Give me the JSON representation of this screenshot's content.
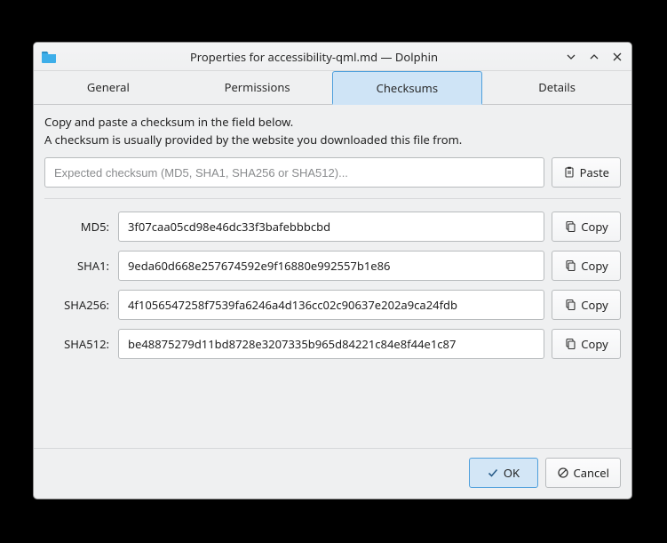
{
  "titlebar": {
    "title": "Properties for accessibility-qml.md — Dolphin"
  },
  "tabs": {
    "general": "General",
    "permissions": "Permissions",
    "checksums": "Checksums",
    "details": "Details"
  },
  "intro": {
    "line1": "Copy and paste a checksum in the field below.",
    "line2": "A checksum is usually provided by the website you downloaded this file from."
  },
  "input": {
    "placeholder": "Expected checksum (MD5, SHA1, SHA256 or SHA512)...",
    "value": ""
  },
  "buttons": {
    "paste": "Paste",
    "copy": "Copy",
    "ok": "OK",
    "cancel": "Cancel"
  },
  "checksums": {
    "md5": {
      "label": "MD5:",
      "value": "3f07caa05cd98e46dc33f3bafebbbcbd"
    },
    "sha1": {
      "label": "SHA1:",
      "value": "9eda60d668e257674592e9f16880e992557b1e86"
    },
    "sha256": {
      "label": "SHA256:",
      "value": "4f1056547258f7539fa6246a4d136cc02c90637e202a9ca24fdb"
    },
    "sha512": {
      "label": "SHA512:",
      "value": "be48875279d11bd8728e3207335b965d84221c84e8f44e1c87"
    }
  }
}
